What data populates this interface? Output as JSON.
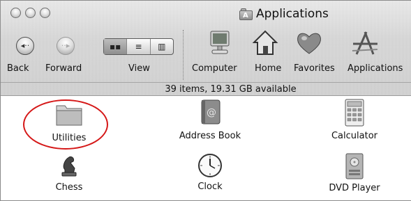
{
  "window": {
    "title": "Applications"
  },
  "toolbar": {
    "back_label": "Back",
    "forward_label": "Forward",
    "view_label": "View",
    "view_modes": [
      "icon",
      "list",
      "column"
    ],
    "selected_view": "icon",
    "locations": [
      {
        "label": "Computer",
        "icon": "computer-icon"
      },
      {
        "label": "Home",
        "icon": "home-icon"
      },
      {
        "label": "Favorites",
        "icon": "heart-icon"
      },
      {
        "label": "Applications",
        "icon": "applications-icon"
      }
    ]
  },
  "status_bar": {
    "text": "39 items, 19.31 GB available"
  },
  "items": [
    {
      "label": "Utilities",
      "icon": "folder-icon",
      "highlighted": true
    },
    {
      "label": "Address Book",
      "icon": "address-book-icon"
    },
    {
      "label": "Calculator",
      "icon": "calculator-icon"
    },
    {
      "label": "Chess",
      "icon": "chess-icon"
    },
    {
      "label": "Clock",
      "icon": "clock-icon"
    },
    {
      "label": "DVD Player",
      "icon": "dvd-player-icon"
    }
  ],
  "colors": {
    "highlight_ring": "#d51717"
  }
}
